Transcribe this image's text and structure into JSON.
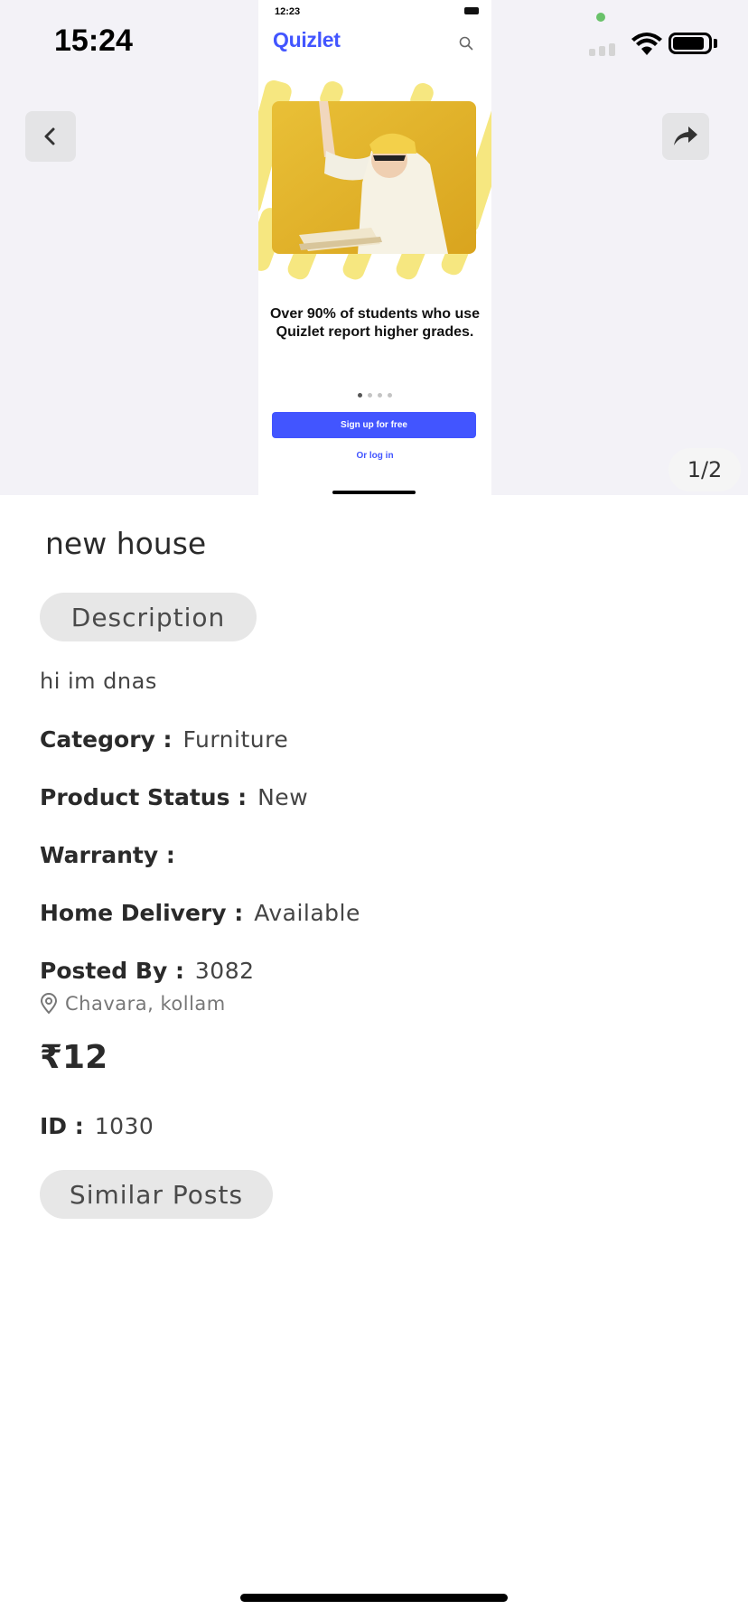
{
  "status_bar": {
    "time": "15:24"
  },
  "gallery": {
    "counter": "1/2",
    "preview": {
      "time": "12:23",
      "logo": "Quizlet",
      "headline_line1": "Over 90% of students who use",
      "headline_line2": "Quizlet report higher grades.",
      "signup_label": "Sign up for free",
      "login_label": "Or log in",
      "accent": "#4255ff"
    }
  },
  "listing": {
    "title": "new house",
    "description_label": "Description",
    "description": "hi im dnas",
    "category_key": "Category :",
    "category_value": "Furniture",
    "status_key": "Product Status :",
    "status_value": "New",
    "warranty_key": "Warranty :",
    "warranty_value": "",
    "delivery_key": "Home Delivery :",
    "delivery_value": "Available",
    "posted_by_key": "Posted By :",
    "posted_by_value": "3082",
    "location": "Chavara, kollam",
    "price": "₹12",
    "id_key": "ID :",
    "id_value": "1030",
    "similar_label": "Similar Posts"
  },
  "icons": {
    "back": "chevron-left-icon",
    "share": "share-arrow-icon",
    "location": "location-pin-icon",
    "wifi": "wifi-icon",
    "battery": "battery-icon"
  }
}
